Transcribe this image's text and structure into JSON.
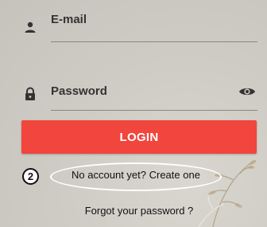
{
  "email": {
    "label": "E-mail",
    "icon": "person-icon"
  },
  "password": {
    "label": "Password",
    "icon": "lock-icon",
    "toggle_icon": "eye-icon"
  },
  "login_button": {
    "label": "LOGIN",
    "color": "#f2453d"
  },
  "annotation": {
    "marker": "2"
  },
  "create_account_link": {
    "label": "No account yet? Create one"
  },
  "forgot_password_link": {
    "label": "Forgot your password ?"
  }
}
